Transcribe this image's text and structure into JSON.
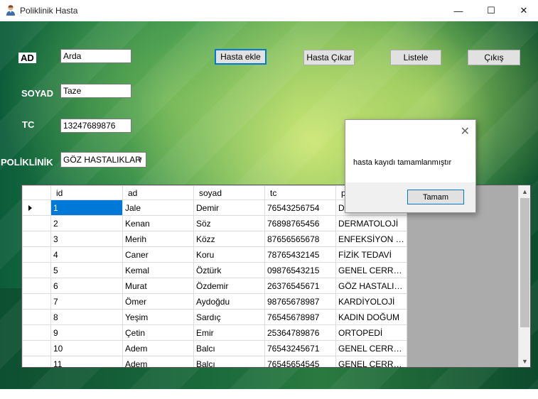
{
  "window": {
    "title": "Poliklinik Hasta",
    "minimize_glyph": "—",
    "maximize_glyph": "☐",
    "close_glyph": "✕"
  },
  "form": {
    "ad_label": "AD",
    "ad_value": "Arda",
    "soyad_label": "SOYAD",
    "soyad_value": "Taze",
    "tc_label": "TC",
    "tc_value": "13247689876",
    "poliklinik_label": "POLİKLİNİK",
    "poliklinik_value": "GÖZ HASTALIKLAR"
  },
  "buttons": {
    "hasta_ekle": "Hasta ekle",
    "hasta_cikar": "Hasta Çıkar",
    "listele": "Listele",
    "cikis": "Çıkış"
  },
  "grid": {
    "columns": [
      "id",
      "ad",
      "soyad",
      "tc",
      "poliklinik"
    ],
    "rows": [
      [
        "1",
        "Jale",
        "Demir",
        "76543256754",
        "DAHİLİYE"
      ],
      [
        "2",
        "Kenan",
        "Söz",
        "76898765456",
        "DERMATOLOJİ"
      ],
      [
        "3",
        "Merih",
        "Közz",
        "87656565678",
        "ENFEKSİYON H..."
      ],
      [
        "4",
        "Caner",
        "Koru",
        "78765432145",
        "FİZİK TEDAVİ"
      ],
      [
        "5",
        "Kemal",
        "Öztürk",
        "09876543215",
        "GENEL CERRAHİ"
      ],
      [
        "6",
        "Murat",
        "Özdemir",
        "26376545671",
        "GÖZ HASTALIK..."
      ],
      [
        "7",
        "Ömer",
        "Aydoğdu",
        "98765678987",
        "KARDİYOLOJİ"
      ],
      [
        "8",
        "Yeşim",
        "Sardıç",
        "76545678987",
        "KADIN DOĞUM"
      ],
      [
        "9",
        "Çetin",
        "Emir",
        "25364789876",
        "ORTOPEDİ"
      ],
      [
        "10",
        "Adem",
        "Balcı",
        "76543245671",
        "GENEL CERRAHİ"
      ],
      [
        "11",
        "Adem",
        "Balcı",
        "76545654545",
        "GENEL CERRAHİ"
      ]
    ]
  },
  "message_box": {
    "text": "hasta kayıdı tamamlanmıştır",
    "ok_label": "Tamam"
  },
  "colors": {
    "accent": "#0078d7",
    "selected_cell": "#0078d7"
  },
  "icons": [
    "app-user-icon",
    "minimize-icon",
    "maximize-icon",
    "close-icon",
    "chevron-down-icon",
    "row-pointer-icon",
    "scroll-up-icon",
    "scroll-down-icon"
  ]
}
